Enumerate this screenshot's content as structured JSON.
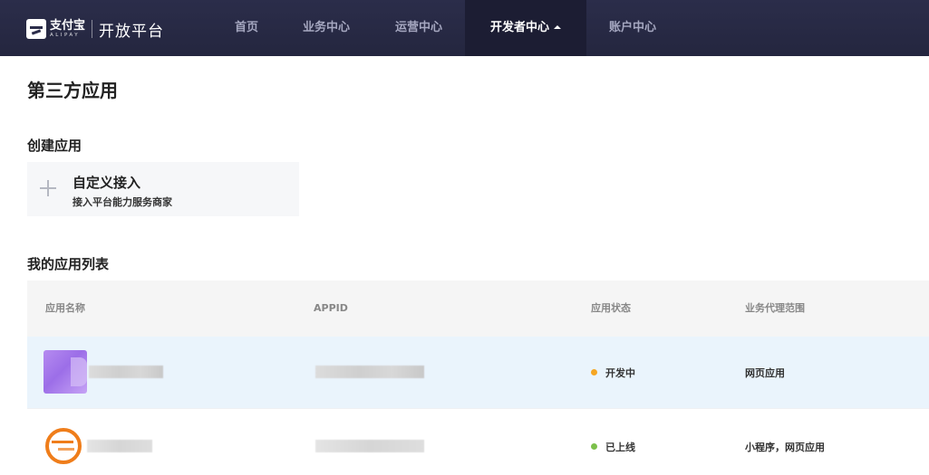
{
  "header": {
    "brand_cn": "支付宝",
    "brand_en": "ALIPAY",
    "brand_sub": "开放平台",
    "nav": [
      {
        "label": "首页"
      },
      {
        "label": "业务中心"
      },
      {
        "label": "运营中心"
      },
      {
        "label": "开发者中心",
        "active": true
      },
      {
        "label": "账户中心"
      }
    ]
  },
  "page": {
    "title": "第三方应用",
    "create_section": "创建应用",
    "create_card": {
      "title": "自定义接入",
      "desc": "接入平台能力服务商家",
      "icon": "plus-icon"
    },
    "list_section": "我的应用列表"
  },
  "table": {
    "columns": [
      "应用名称",
      "APPID",
      "应用状态",
      "业务代理范围"
    ],
    "rows": [
      {
        "status": "开发中",
        "status_color": "#f5a623",
        "scope": "网页应用",
        "icon": "app-icon-violet"
      },
      {
        "status": "已上线",
        "status_color": "#7cc04b",
        "scope": "小程序，网页应用",
        "icon": "app-icon-orange-logo"
      }
    ]
  },
  "colors": {
    "topbar": "#2b2d4a",
    "active_nav": "#1c1d33",
    "highlight_row": "#eaf4fc"
  }
}
